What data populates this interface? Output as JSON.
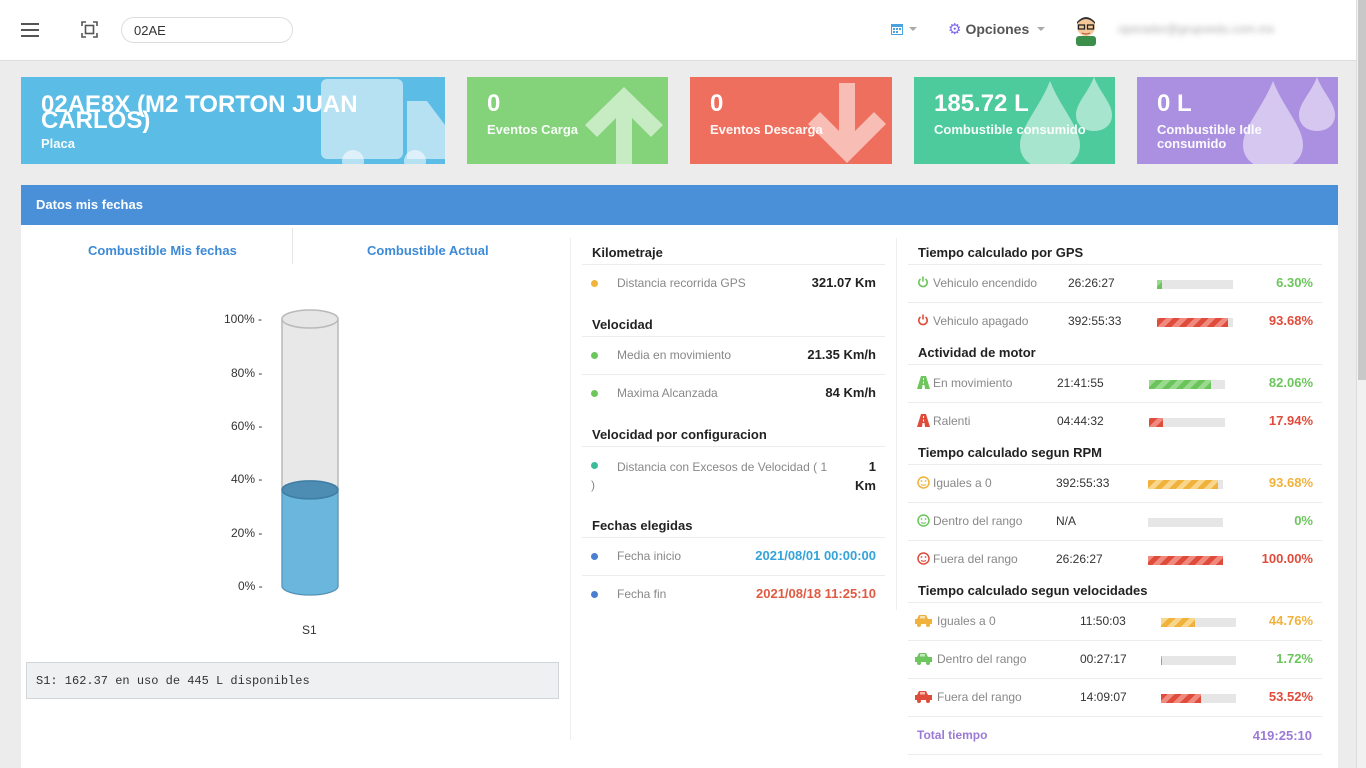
{
  "navbar": {
    "search_value": "02AE",
    "options_label": "Opciones",
    "username": "operador@grupoedu.com.mx"
  },
  "cards": [
    {
      "value": "02AE8X (M2 TORTON JUAN CARLOS)",
      "label": "Placa",
      "icon": "truck-icon",
      "color": "#5bbce5"
    },
    {
      "value": "0",
      "label": "Eventos Carga",
      "icon": "arrow-up-icon",
      "color": "#84d37a"
    },
    {
      "value": "0",
      "label": "Eventos Descarga",
      "icon": "arrow-down-icon",
      "color": "#ef6f5e"
    },
    {
      "value": "185.72 L",
      "label": "Combustible consumido",
      "icon": "drop-icon",
      "color": "#4ecb9d"
    },
    {
      "value": "0 L",
      "label": "Combustible Idle consumido",
      "icon": "drop-icon",
      "color": "#ab8fe0"
    }
  ],
  "panel": {
    "title": "Datos mis fechas",
    "tabs": [
      "Combustible Mis fechas",
      "Combustible Actual"
    ]
  },
  "tank": {
    "axis": [
      "100% -",
      "80% -",
      "60% -",
      "40% -",
      "20% -",
      "0% -"
    ],
    "level_percent": 36,
    "sensor_label": "S1",
    "info": "S1: 162.37 en uso de 445 L disponibles"
  },
  "middle": {
    "kilometraje": {
      "title": "Kilometraje",
      "rows": [
        {
          "label": "Distancia recorrida GPS",
          "value": "321.07 Km",
          "dot": "#f0b43c"
        }
      ]
    },
    "velocidad": {
      "title": "Velocidad",
      "rows": [
        {
          "label": "Media en movimiento",
          "value": "21.35 Km/h",
          "dot": "#6cc65c"
        },
        {
          "label": "Maxima Alcanzada",
          "value": "84 Km/h",
          "dot": "#6cc65c"
        }
      ]
    },
    "config": {
      "title": "Velocidad por configuracion",
      "label_a": "Distancia con Excesos de Velocidad ( 1",
      "label_b": ")",
      "value_a": "1",
      "value_b": "Km",
      "dot": "#3cbc9a"
    },
    "fechas": {
      "title": "Fechas elegidas",
      "rows": [
        {
          "label": "Fecha inicio",
          "value": "2021/08/01 00:00:00",
          "color": "#35a3d9",
          "dot": "#4a7fd0"
        },
        {
          "label": "Fecha fin",
          "value": "2021/08/18 11:25:10",
          "color": "#e05a43",
          "dot": "#4a7fd0"
        }
      ]
    }
  },
  "right": {
    "gps": {
      "title": "Tiempo calculado por GPS",
      "rows": [
        {
          "label": "Vehiculo encendido",
          "time": "26:26:27",
          "percent": "6.30%",
          "fill": 0.063,
          "color": "#6cc65c",
          "icon": "power-icon"
        },
        {
          "label": "Vehiculo apagado",
          "time": "392:55:33",
          "percent": "93.68%",
          "fill": 0.9368,
          "color": "#e04c3b",
          "icon": "power-icon"
        }
      ]
    },
    "motor": {
      "title": "Actividad de motor",
      "rows": [
        {
          "label": "En movimiento",
          "time": "21:41:55",
          "percent": "82.06%",
          "fill": 0.8206,
          "color": "#6cc65c",
          "icon": "road-icon"
        },
        {
          "label": "Ralenti",
          "time": "04:44:32",
          "percent": "17.94%",
          "fill": 0.1794,
          "color": "#e04c3b",
          "icon": "road-icon"
        }
      ]
    },
    "rpm": {
      "title": "Tiempo calculado segun RPM",
      "rows": [
        {
          "label": "Iguales a 0",
          "time": "392:55:33",
          "percent": "93.68%",
          "fill": 0.9368,
          "color": "#f1b23b",
          "icon": "gauge-icon"
        },
        {
          "label": "Dentro del rango",
          "time": "N/A",
          "percent": "0%",
          "fill": 0,
          "color": "#6cc65c",
          "icon": "gauge-icon"
        },
        {
          "label": "Fuera del rango",
          "time": "26:26:27",
          "percent": "100.00%",
          "fill": 1.0,
          "color": "#e04c3b",
          "icon": "gauge-icon"
        }
      ]
    },
    "vel": {
      "title": "Tiempo calculado segun velocidades",
      "rows": [
        {
          "label": "Iguales a 0",
          "time": "11:50:03",
          "percent": "44.76%",
          "fill": 0.4476,
          "color": "#f1b23b",
          "icon": "car-icon"
        },
        {
          "label": "Dentro del rango",
          "time": "00:27:17",
          "percent": "1.72%",
          "fill": 0.0172,
          "color": "#6cc65c",
          "icon": "car-icon"
        },
        {
          "label": "Fuera del rango",
          "time": "14:09:07",
          "percent": "53.52%",
          "fill": 0.5352,
          "color": "#e04c3b",
          "icon": "car-icon"
        }
      ]
    },
    "total_label": "Total tiempo",
    "total_value": "419:25:10"
  }
}
